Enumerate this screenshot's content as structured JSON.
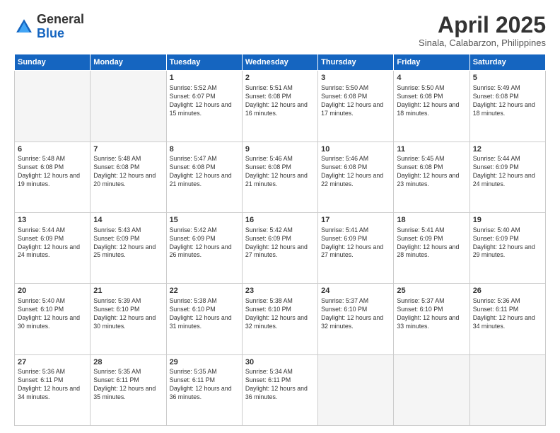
{
  "logo": {
    "general": "General",
    "blue": "Blue"
  },
  "title": "April 2025",
  "subtitle": "Sinala, Calabarzon, Philippines",
  "days_of_week": [
    "Sunday",
    "Monday",
    "Tuesday",
    "Wednesday",
    "Thursday",
    "Friday",
    "Saturday"
  ],
  "weeks": [
    [
      {
        "num": "",
        "empty": true
      },
      {
        "num": "",
        "empty": true
      },
      {
        "num": "1",
        "sunrise": "5:52 AM",
        "sunset": "6:07 PM",
        "daylight": "12 hours and 15 minutes."
      },
      {
        "num": "2",
        "sunrise": "5:51 AM",
        "sunset": "6:08 PM",
        "daylight": "12 hours and 16 minutes."
      },
      {
        "num": "3",
        "sunrise": "5:50 AM",
        "sunset": "6:08 PM",
        "daylight": "12 hours and 17 minutes."
      },
      {
        "num": "4",
        "sunrise": "5:50 AM",
        "sunset": "6:08 PM",
        "daylight": "12 hours and 18 minutes."
      },
      {
        "num": "5",
        "sunrise": "5:49 AM",
        "sunset": "6:08 PM",
        "daylight": "12 hours and 18 minutes."
      }
    ],
    [
      {
        "num": "6",
        "sunrise": "5:48 AM",
        "sunset": "6:08 PM",
        "daylight": "12 hours and 19 minutes."
      },
      {
        "num": "7",
        "sunrise": "5:48 AM",
        "sunset": "6:08 PM",
        "daylight": "12 hours and 20 minutes."
      },
      {
        "num": "8",
        "sunrise": "5:47 AM",
        "sunset": "6:08 PM",
        "daylight": "12 hours and 21 minutes."
      },
      {
        "num": "9",
        "sunrise": "5:46 AM",
        "sunset": "6:08 PM",
        "daylight": "12 hours and 21 minutes."
      },
      {
        "num": "10",
        "sunrise": "5:46 AM",
        "sunset": "6:08 PM",
        "daylight": "12 hours and 22 minutes."
      },
      {
        "num": "11",
        "sunrise": "5:45 AM",
        "sunset": "6:08 PM",
        "daylight": "12 hours and 23 minutes."
      },
      {
        "num": "12",
        "sunrise": "5:44 AM",
        "sunset": "6:09 PM",
        "daylight": "12 hours and 24 minutes."
      }
    ],
    [
      {
        "num": "13",
        "sunrise": "5:44 AM",
        "sunset": "6:09 PM",
        "daylight": "12 hours and 24 minutes."
      },
      {
        "num": "14",
        "sunrise": "5:43 AM",
        "sunset": "6:09 PM",
        "daylight": "12 hours and 25 minutes."
      },
      {
        "num": "15",
        "sunrise": "5:42 AM",
        "sunset": "6:09 PM",
        "daylight": "12 hours and 26 minutes."
      },
      {
        "num": "16",
        "sunrise": "5:42 AM",
        "sunset": "6:09 PM",
        "daylight": "12 hours and 27 minutes."
      },
      {
        "num": "17",
        "sunrise": "5:41 AM",
        "sunset": "6:09 PM",
        "daylight": "12 hours and 27 minutes."
      },
      {
        "num": "18",
        "sunrise": "5:41 AM",
        "sunset": "6:09 PM",
        "daylight": "12 hours and 28 minutes."
      },
      {
        "num": "19",
        "sunrise": "5:40 AM",
        "sunset": "6:09 PM",
        "daylight": "12 hours and 29 minutes."
      }
    ],
    [
      {
        "num": "20",
        "sunrise": "5:40 AM",
        "sunset": "6:10 PM",
        "daylight": "12 hours and 30 minutes."
      },
      {
        "num": "21",
        "sunrise": "5:39 AM",
        "sunset": "6:10 PM",
        "daylight": "12 hours and 30 minutes."
      },
      {
        "num": "22",
        "sunrise": "5:38 AM",
        "sunset": "6:10 PM",
        "daylight": "12 hours and 31 minutes."
      },
      {
        "num": "23",
        "sunrise": "5:38 AM",
        "sunset": "6:10 PM",
        "daylight": "12 hours and 32 minutes."
      },
      {
        "num": "24",
        "sunrise": "5:37 AM",
        "sunset": "6:10 PM",
        "daylight": "12 hours and 32 minutes."
      },
      {
        "num": "25",
        "sunrise": "5:37 AM",
        "sunset": "6:10 PM",
        "daylight": "12 hours and 33 minutes."
      },
      {
        "num": "26",
        "sunrise": "5:36 AM",
        "sunset": "6:11 PM",
        "daylight": "12 hours and 34 minutes."
      }
    ],
    [
      {
        "num": "27",
        "sunrise": "5:36 AM",
        "sunset": "6:11 PM",
        "daylight": "12 hours and 34 minutes."
      },
      {
        "num": "28",
        "sunrise": "5:35 AM",
        "sunset": "6:11 PM",
        "daylight": "12 hours and 35 minutes."
      },
      {
        "num": "29",
        "sunrise": "5:35 AM",
        "sunset": "6:11 PM",
        "daylight": "12 hours and 36 minutes."
      },
      {
        "num": "30",
        "sunrise": "5:34 AM",
        "sunset": "6:11 PM",
        "daylight": "12 hours and 36 minutes."
      },
      {
        "num": "",
        "empty": true
      },
      {
        "num": "",
        "empty": true
      },
      {
        "num": "",
        "empty": true
      }
    ]
  ]
}
